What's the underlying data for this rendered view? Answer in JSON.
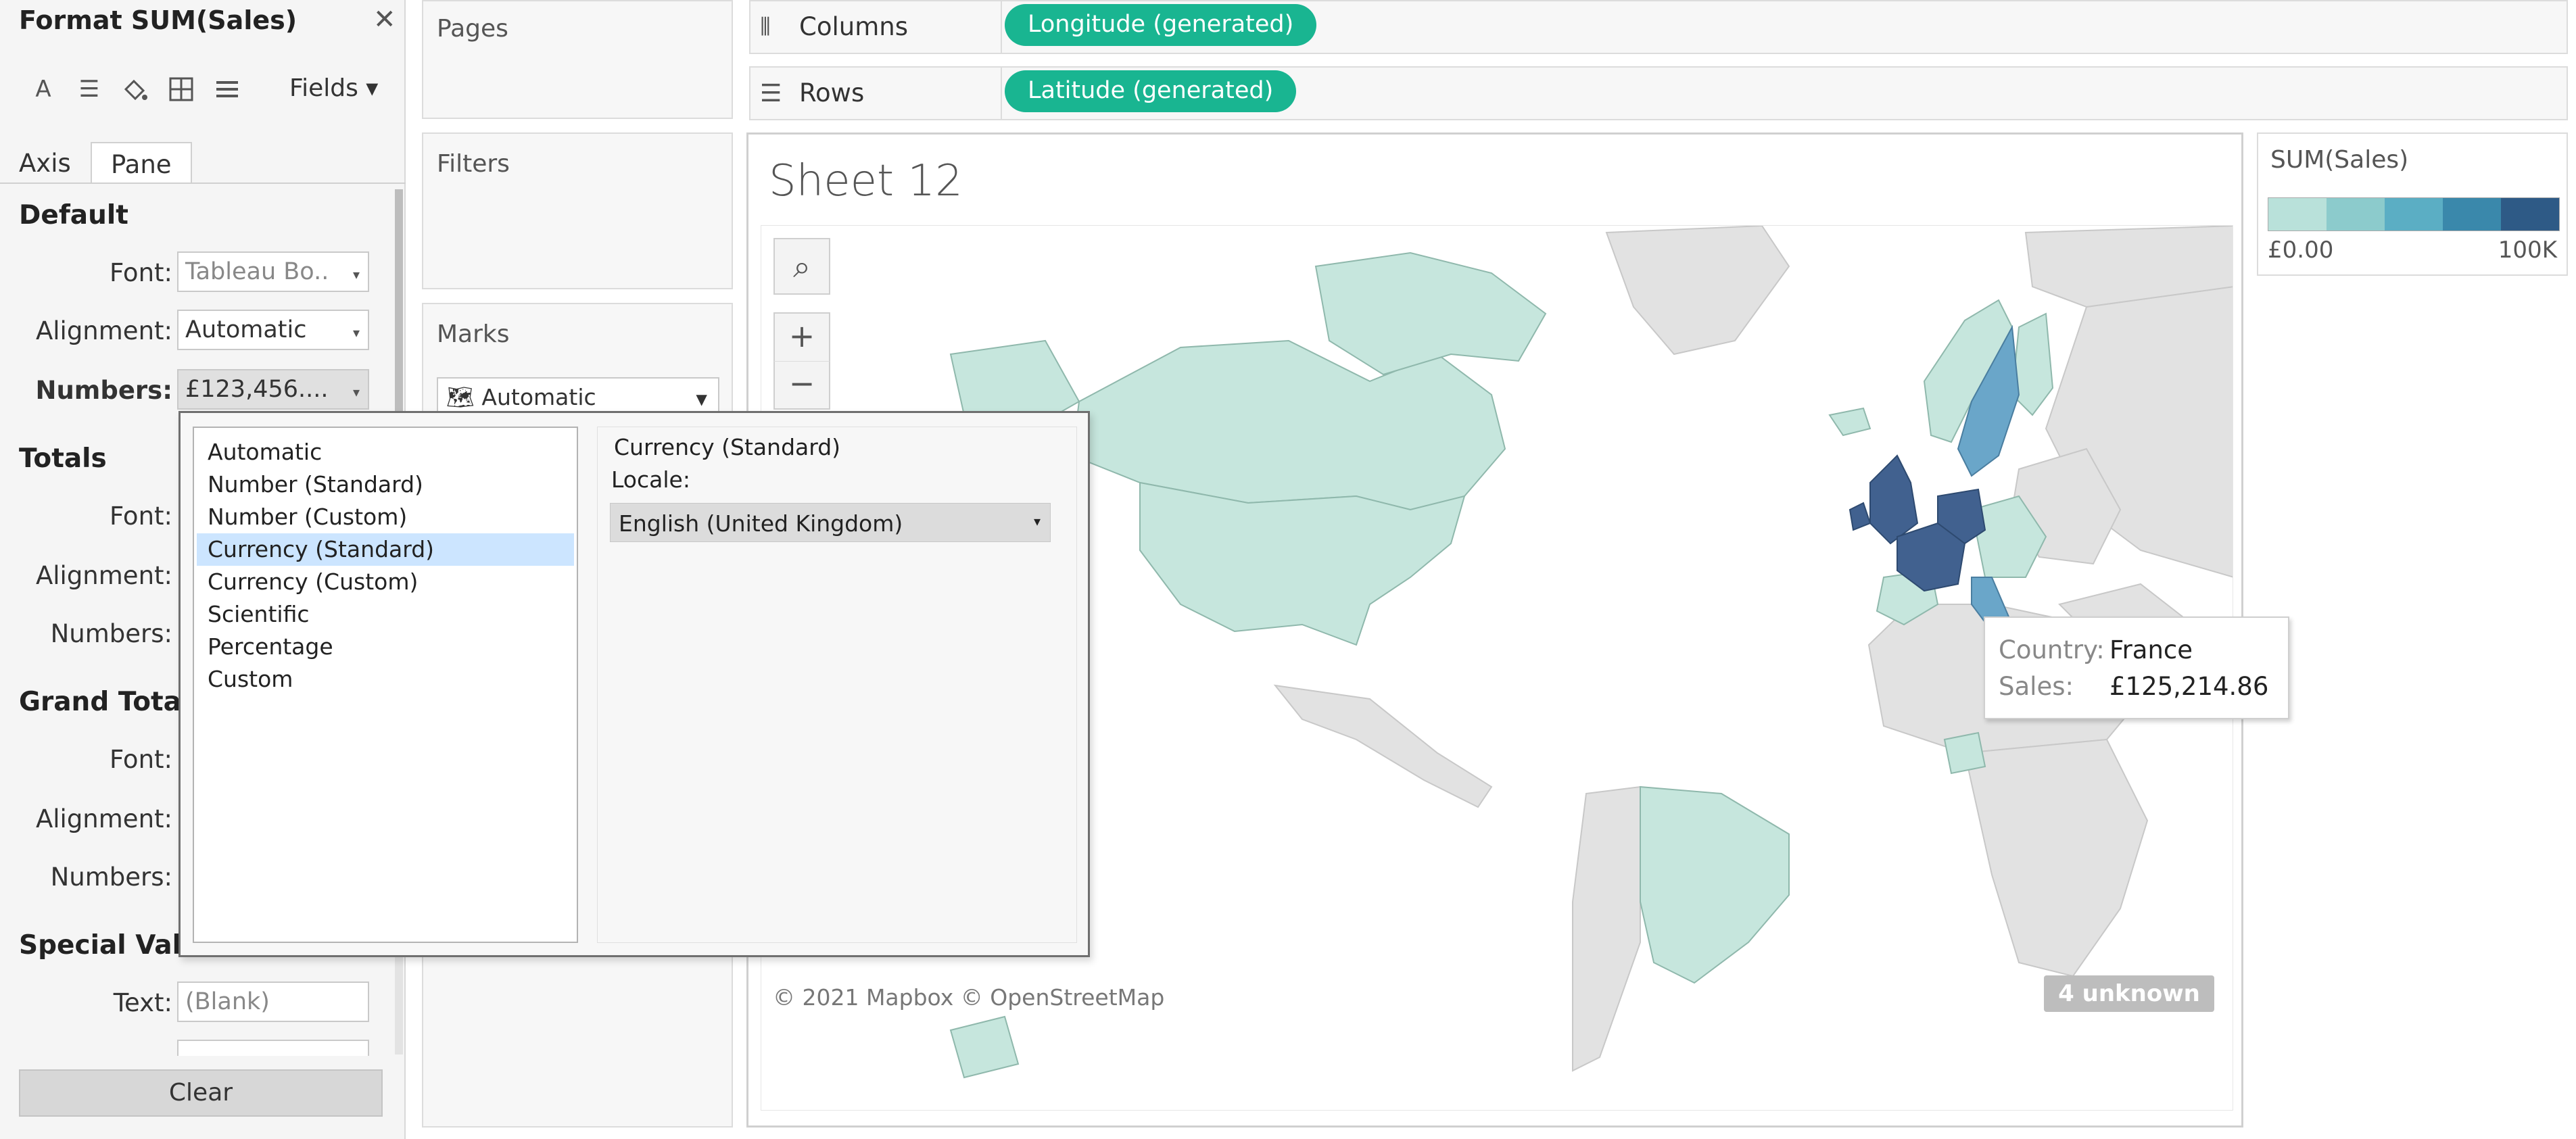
{
  "format_pane": {
    "title": "Format SUM(Sales)",
    "close_icon": "close-icon",
    "toolbar_icons": [
      "font-icon",
      "alignment-icon",
      "shading-icon",
      "borders-icon",
      "lines-icon"
    ],
    "fields_label": "Fields ▾",
    "tabs": [
      {
        "label": "Axis"
      },
      {
        "label": "Pane"
      }
    ],
    "active_tab": "Pane",
    "sections": {
      "default": {
        "header": "Default",
        "font_label": "Font:",
        "font_value": "Tableau Bo..",
        "alignment_label": "Alignment:",
        "alignment_value": "Automatic",
        "numbers_label": "Numbers:",
        "numbers_value": "£123,456...."
      },
      "totals": {
        "header": "Totals",
        "font_label": "Font:",
        "alignment_label": "Alignment:",
        "numbers_label": "Numbers:"
      },
      "grand_totals": {
        "header": "Grand Totals",
        "font_label": "Font:",
        "alignment_label": "Alignment:",
        "numbers_label": "Numbers:"
      },
      "special_values": {
        "header": "Special Valu",
        "text_label": "Text:",
        "text_value": "(Blank)"
      }
    },
    "clear_label": "Clear"
  },
  "cards": {
    "pages": "Pages",
    "filters": "Filters",
    "marks": "Marks",
    "marks_type": "Automatic"
  },
  "shelves": {
    "columns": {
      "label": "Columns",
      "pill": "Longitude (generated)"
    },
    "rows": {
      "label": "Rows",
      "pill": "Latitude (generated)"
    }
  },
  "view": {
    "title": "Sheet 12",
    "map_controls": [
      "search-icon",
      "zoom-in-icon",
      "zoom-out-icon"
    ],
    "attribution": "© 2021 Mapbox © OpenStreetMap",
    "unknown_badge": "4 unknown"
  },
  "tooltip": {
    "country_label": "Country:",
    "country_value": "France",
    "sales_label": "Sales:",
    "sales_value": "£125,214.86"
  },
  "legend": {
    "title": "SUM(Sales)",
    "min_label": "£0.00",
    "max_label": "100K",
    "colors": [
      "#b9e1da",
      "#8ccbcc",
      "#5baec4",
      "#3a88ab",
      "#2e5a86"
    ]
  },
  "number_format_popup": {
    "options": [
      "Automatic",
      "Number (Standard)",
      "Number (Custom)",
      "Currency (Standard)",
      "Currency (Custom)",
      "Scientific",
      "Percentage",
      "Custom"
    ],
    "selected": "Currency (Standard)",
    "detail_title": "Currency (Standard)",
    "locale_label": "Locale:",
    "locale_value": "English (United Kingdom)"
  },
  "colors": {
    "pill": "#19b591",
    "selection": "#cce5ff",
    "map_low": "#c6e6dd",
    "map_mid": "#6aa6c9",
    "map_high": "#41618f",
    "land_nodata": "#e2e2e2"
  }
}
